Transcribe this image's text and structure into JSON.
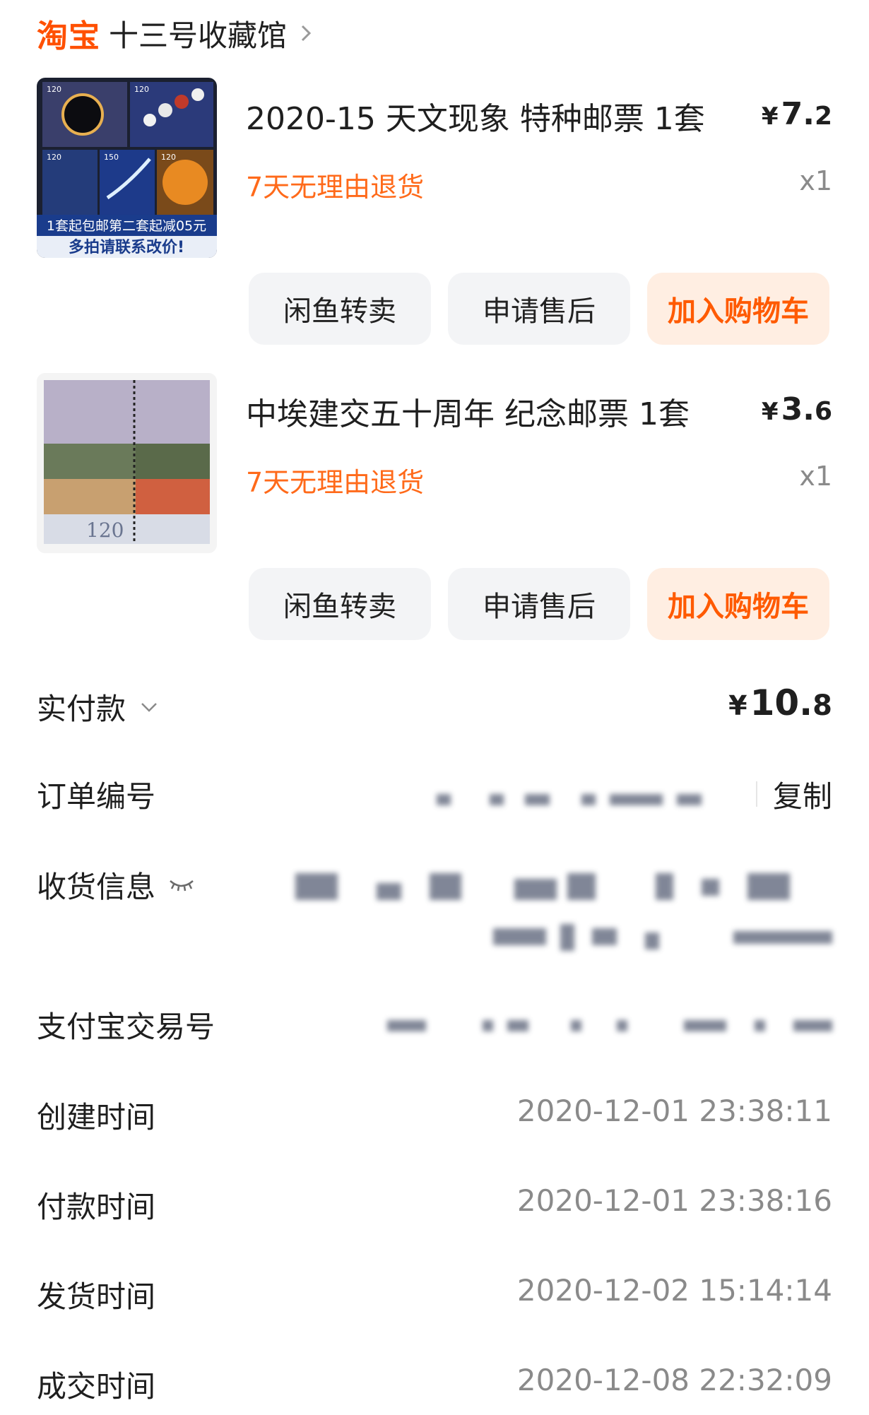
{
  "shop": {
    "logo": "淘宝",
    "name": "十三号收藏馆"
  },
  "items": [
    {
      "title": "2020-15 天文现象 特种邮票 1套",
      "price_yen": "¥",
      "price_int": "7.",
      "price_dec": "2",
      "return_policy": "7天无理由退货",
      "qty": "x1",
      "thumb_caption_1": "1套起包邮第二套起减05元",
      "thumb_caption_2": "多拍请联系改价!",
      "stamp_value_labels": [
        "120",
        "120",
        "120",
        "150",
        "120"
      ],
      "actions": [
        "闲鱼转卖",
        "申请售后",
        "加入购物车"
      ]
    },
    {
      "title": "中埃建交五十周年 纪念邮票 1套",
      "price_yen": "¥",
      "price_int": "3.",
      "price_dec": "6",
      "return_policy": "7天无理由退货",
      "qty": "x1",
      "stamp_value_label": "120",
      "actions": [
        "闲鱼转卖",
        "申请售后",
        "加入购物车"
      ]
    }
  ],
  "details": {
    "paid_label": "实付款",
    "paid_yen": "¥",
    "paid_int": "10.",
    "paid_dec": "8",
    "order_no_label": "订单编号",
    "copy_label": "复制",
    "shipping_label": "收货信息",
    "alipay_label": "支付宝交易号",
    "created_label": "创建时间",
    "created_value": "2020-12-01 23:38:11",
    "paid_time_label": "付款时间",
    "paid_time_value": "2020-12-01 23:38:16",
    "shipped_label": "发货时间",
    "shipped_value": "2020-12-02 15:14:14",
    "completed_label": "成交时间",
    "completed_value": "2020-12-08 22:32:09"
  },
  "colors": {
    "accent": "#ff5000",
    "return_text": "#ff6a1a",
    "button_gray": "#f3f4f6",
    "button_orange_bg": "#ffeee2"
  },
  "icons": [
    "chevron-right-icon",
    "chevron-down-icon",
    "eye-closed-icon"
  ]
}
